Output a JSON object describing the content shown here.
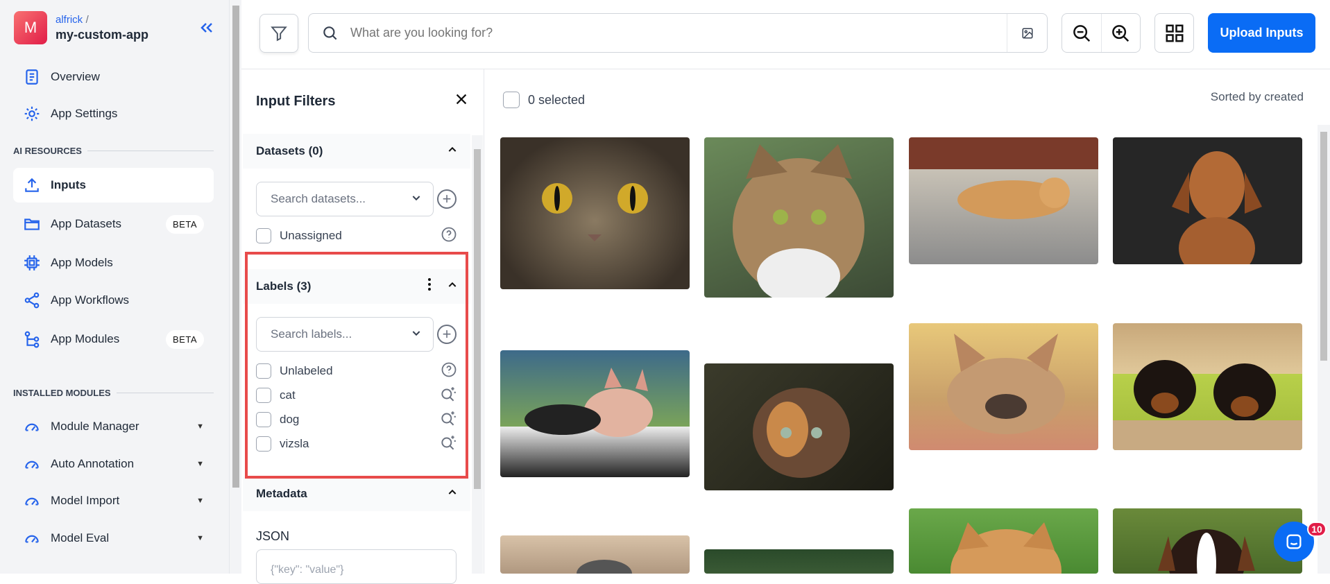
{
  "app": {
    "avatar_letter": "M",
    "owner": "alfrick",
    "owner_sep": "/",
    "name": "my-custom-app"
  },
  "nav": {
    "overview": "Overview",
    "settings": "App Settings",
    "ai_resources_heading": "AI RESOURCES",
    "inputs": "Inputs",
    "datasets": "App Datasets",
    "datasets_badge": "BETA",
    "models": "App Models",
    "workflows": "App Workflows",
    "modules": "App Modules",
    "modules_badge": "BETA",
    "installed_heading": "INSTALLED MODULES",
    "installed": [
      "Module Manager",
      "Auto Annotation",
      "Model Import",
      "Model Eval"
    ]
  },
  "toolbar": {
    "search_placeholder": "What are you looking for?",
    "upload_label": "Upload Inputs"
  },
  "filters": {
    "title": "Input Filters",
    "datasets_header": "Datasets (0)",
    "datasets_search_placeholder": "Search datasets...",
    "datasets_unassigned": "Unassigned",
    "labels_header": "Labels (3)",
    "labels_search_placeholder": "Search labels...",
    "labels": [
      "Unlabeled",
      "cat",
      "dog",
      "vizsla"
    ],
    "metadata_header": "Metadata",
    "json_label": "JSON",
    "json_placeholder": "{\"key\": \"value\"}"
  },
  "main": {
    "selected_text": "0 selected",
    "sort_text": "Sorted by created"
  },
  "images": [
    "cat-closeup-yellow-eyes",
    "tabby-cat-green-eyes",
    "sleeping-orange-kitten",
    "vizsla-dog-dark-background",
    "sphynx-cat-lying",
    "calico-cat-outdoors",
    "french-bulldog-lying",
    "rottweiler-puppies",
    "cat-on-wood",
    "dog-in-grass",
    "orange-cat-grass",
    "beagle-puppy"
  ],
  "chat_badge": "10",
  "colors": {
    "accent": "#0a6cf5",
    "highlight": "#e84b4b"
  }
}
